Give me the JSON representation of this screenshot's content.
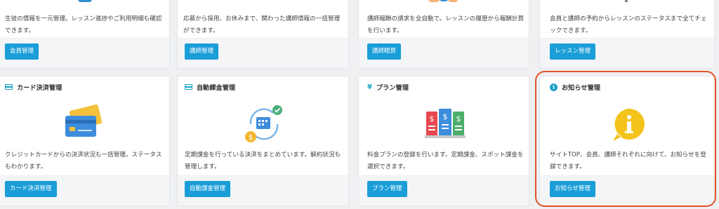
{
  "top_row": [
    {
      "desc": "生徒の情報を一元管理。レッスン進捗やご利用明細も確認できます。",
      "button": "会員管理"
    },
    {
      "desc": "応募から採用、お休みまで、関わった講師情報の一括管理ができます。",
      "button": "講師管理"
    },
    {
      "desc": "講師報酬の請求を全自動で。レッスンの履歴から報酬計算を行います。",
      "button": "講師精算"
    },
    {
      "desc": "会員と講師の予約からレッスンのステータスまで全てチェックできます。",
      "button": "レッスン管理"
    }
  ],
  "bottom_row": [
    {
      "title": "カード決済管理",
      "icon": "credit-card-icon",
      "desc": "クレジットカードからの決済状況も一括管理。ステータスもわかります。",
      "button": "カード決済管理"
    },
    {
      "title": "自動課金管理",
      "icon": "credit-card-icon",
      "desc": "定期課金を行っている決済をまとめています。解約状況も管理します。",
      "button": "自動課金管理"
    },
    {
      "title": "プラン管理",
      "icon": "yen-icon",
      "desc": "料金プランの登録を行います。定期課金、スポット課金を選択できます。",
      "button": "プラン管理"
    },
    {
      "title": "お知らせ管理",
      "icon": "info-icon",
      "desc": "サイトTOP、会員、講師それぞれに向けて、お知らせを登録できます。",
      "button": "お知らせ管理"
    }
  ],
  "icons": {
    "yen_glyph": "¥",
    "info_glyph": "i"
  },
  "colors": {
    "accent": "#1a9ed8",
    "highlight": "#e2532c",
    "info_yellow": "#f3c31b"
  }
}
